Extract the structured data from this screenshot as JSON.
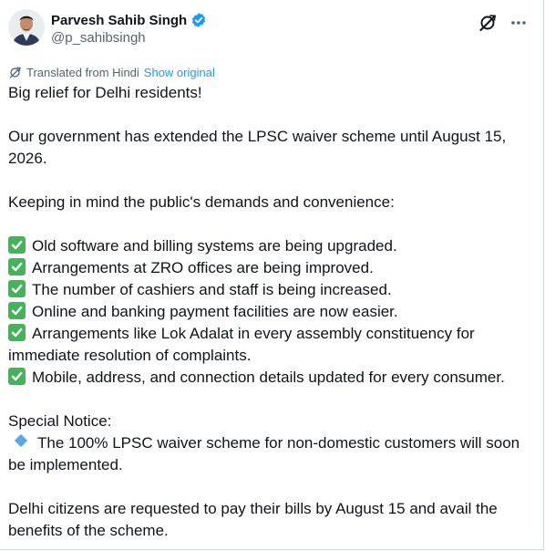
{
  "tweet": {
    "author": {
      "display_name": "Parvesh Sahib Singh",
      "handle": "@p_sahibsingh",
      "verified": true,
      "verified_color": "#1d9bf0"
    },
    "icons": {
      "avatar": "avatar",
      "verified": "verified-badge-icon",
      "grok": "grok-icon",
      "more": "more-icon",
      "translate": "translate-icon",
      "check": "check-mark-icon",
      "diamond": "blue-diamond-icon"
    },
    "translation": {
      "label": "Translated from Hindi",
      "show_original": "Show original",
      "link_color": "#1d9bf0"
    },
    "text": {
      "intro": "Big relief for Delhi residents!",
      "extension": "Our government has extended the LPSC waiver scheme until August 15, 2026.",
      "keeping_in_mind": "Keeping in mind the public's demands and convenience:",
      "checklist": [
        "Old software and billing systems are being upgraded.",
        "Arrangements at ZRO offices are being improved.",
        "The number of cashiers and staff is being increased.",
        "Online and banking payment facilities are now easier.",
        "Arrangements like Lok Adalat in every assembly constituency for immediate resolution of complaints.",
        "Mobile, address, and connection details updated for every consumer."
      ],
      "special_notice": "Special Notice:",
      "notice_item": "The 100% LPSC waiver scheme for non-domestic customers will soon be implemented.",
      "closing": "Delhi citizens are requested to pay their bills by August 15 and avail the benefits of the scheme."
    }
  }
}
